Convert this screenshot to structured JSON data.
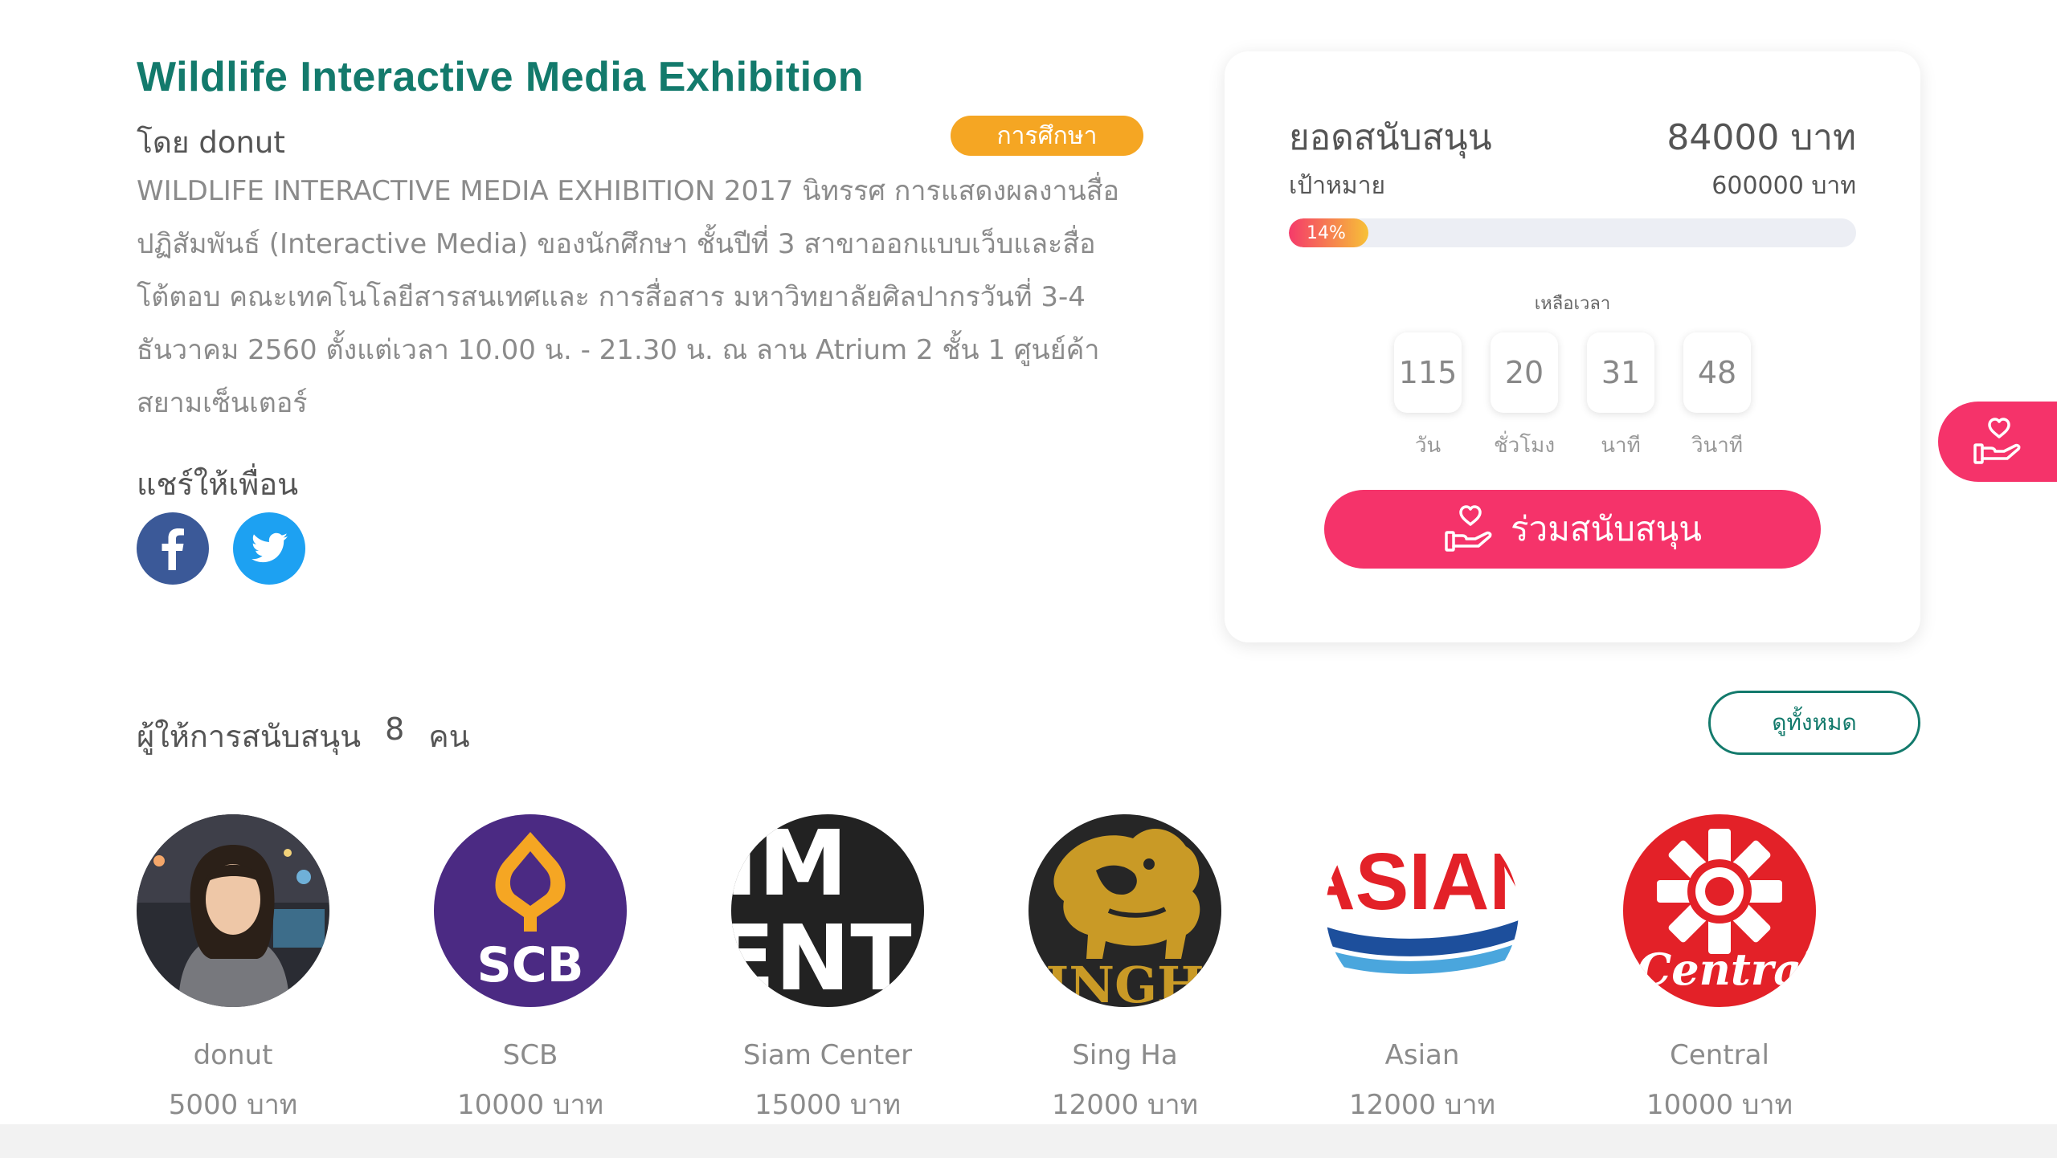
{
  "project": {
    "title": "Wildlife Interactive Media Exhibition",
    "byline": "โดย donut",
    "category": "การศึกษา",
    "description": "WILDLIFE INTERACTIVE MEDIA EXHIBITION 2017 นิทรรศ การแสดงผลงานสื่อปฏิสัมพันธ์ (Interactive Media) ของนักศึกษา ชั้นปีที่ 3 สาขาออกแบบเว็บและสื่อโต้ตอบ คณะเทคโนโลยีสารสนเทศและ การสื่อสาร มหาวิทยาลัยศิลปากรวันที่ 3-4 ธันวาคม 2560 ตั้งแต่เวลา 10.00 น. - 21.30 น. ณ ลาน Atrium 2 ชั้น 1 ศูนย์ค้าสยามเซ็นเตอร์"
  },
  "share": {
    "title": "แชร์ให้เพื่อน",
    "icons": [
      "facebook-icon",
      "twitter-icon"
    ]
  },
  "funding": {
    "raised_label": "ยอดสนับสนุน",
    "raised_value": "84000 บาท",
    "goal_label": "เป้าหมาย",
    "goal_value": "600000 บาท",
    "progress_text": "14%",
    "progress_fraction": 0.14,
    "remaining_label": "เหลือเวลา",
    "countdown": [
      {
        "value": "115",
        "label": "วัน"
      },
      {
        "value": "20",
        "label": "ชั่วโมง"
      },
      {
        "value": "31",
        "label": "นาที"
      },
      {
        "value": "48",
        "label": "วินาที"
      }
    ],
    "support_button": "ร่วมสนับสนุน"
  },
  "supporters": {
    "header_label": "ผู้ให้การสนับสนุน",
    "count": "8",
    "count_unit": "คน",
    "view_all": "ดูทั้งหมด",
    "items": [
      {
        "name": "donut",
        "amount": "5000 บาท"
      },
      {
        "name": "SCB",
        "amount": "10000 บาท",
        "logo_text": "SCB"
      },
      {
        "name": "Siam Center",
        "amount": "15000 บาท",
        "logo_text_1": "IM",
        "logo_text_2": "ENT"
      },
      {
        "name": "Sing Ha",
        "amount": "12000 บาท",
        "logo_text": "INGH"
      },
      {
        "name": "Asian",
        "amount": "12000 บาท",
        "logo_text": "ASIAN"
      },
      {
        "name": "Central",
        "amount": "10000 บาท",
        "logo_text": "Central"
      }
    ]
  },
  "colors": {
    "title_green": "#137a6c",
    "accent_pink": "#f5336a",
    "badge_orange": "#f5a623"
  }
}
